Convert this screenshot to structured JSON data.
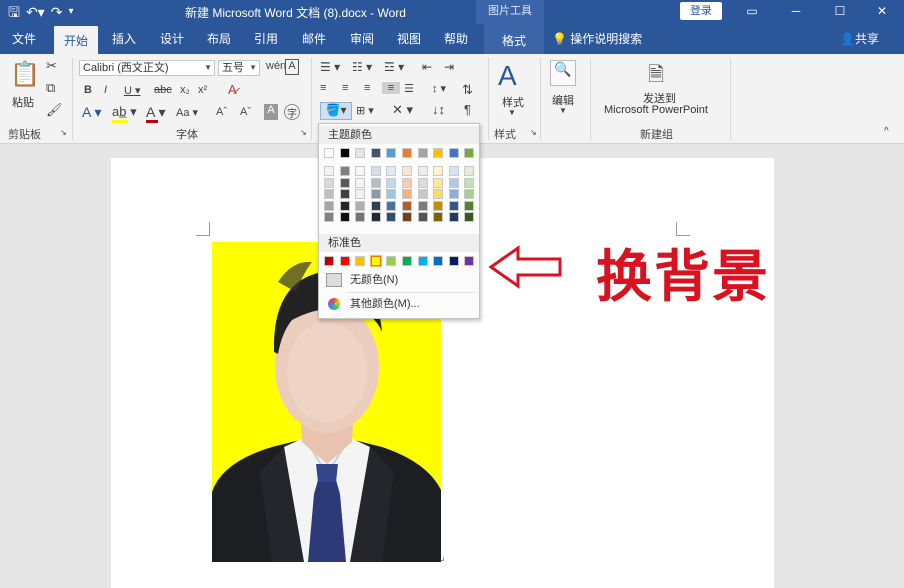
{
  "titlebar": {
    "title": "新建 Microsoft Word 文档 (8).docx  -  Word",
    "context_tools": "图片工具",
    "login": "登录"
  },
  "tabs": [
    "文件",
    "开始",
    "插入",
    "设计",
    "布局",
    "引用",
    "邮件",
    "审阅",
    "视图",
    "帮助"
  ],
  "context_tab": "格式",
  "tell_me": "操作说明搜索",
  "share": "共享",
  "ribbon": {
    "paste_label": "粘贴",
    "clipboard_label": "剪贴板",
    "font_name": "Calibri (西文正文)",
    "font_size": "五号",
    "font_group_label": "字体",
    "styles_label": "样式",
    "styles_group_label": "样式",
    "editing_label": "编辑",
    "send_label_1": "发送到",
    "send_label_2": "Microsoft PowerPoint",
    "new_group_label": "新建组"
  },
  "dropdown": {
    "theme_colors_label": "主题颜色",
    "standard_colors_label": "标准色",
    "no_color_label": "无颜色(N)",
    "more_colors_label": "其他颜色(M)...",
    "theme_top": [
      "#ffffff",
      "#000000",
      "#e7e6e6",
      "#44546a",
      "#5b9bd5",
      "#ed7d31",
      "#a5a5a5",
      "#ffc000",
      "#4472c4",
      "#70ad47"
    ],
    "standard": [
      "#c00000",
      "#ff0000",
      "#ffc000",
      "#ffff00",
      "#92d050",
      "#00b050",
      "#00b0f0",
      "#0070c0",
      "#002060",
      "#7030a0"
    ]
  },
  "annotation": {
    "text": "换背景",
    "color": "#d8121e"
  },
  "photo": {
    "background_color": "#ffff00"
  }
}
